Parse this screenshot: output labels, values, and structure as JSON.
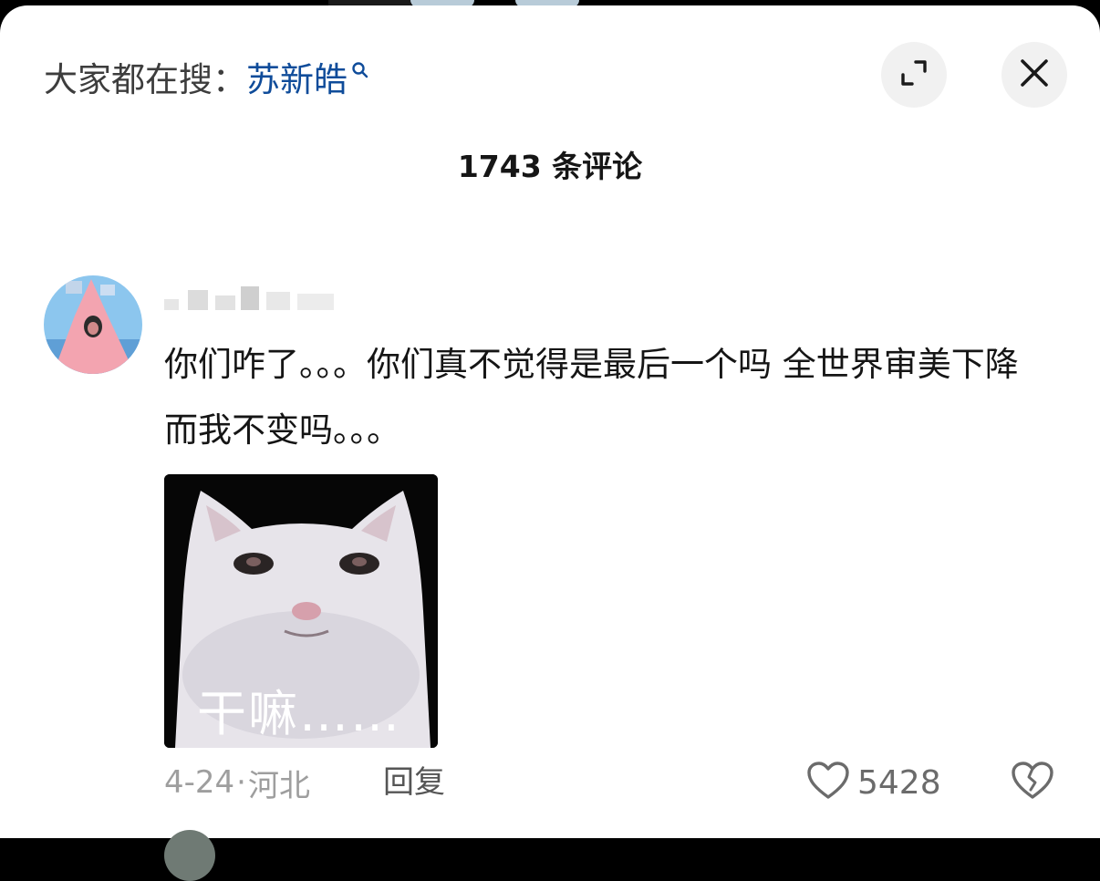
{
  "header": {
    "search_hint_prefix": "大家都在搜：",
    "search_keyword": "苏新皓",
    "search_icon": "search-icon",
    "expand_icon": "expand-icon",
    "close_icon": "close-icon"
  },
  "comments_title": "1743 条评论",
  "comment": {
    "avatar_icon": "avatar-patrick-star",
    "username_obscured": true,
    "text": "你们咋了。。。你们真不觉得是最后一个吗 全世界审美下降而我不变吗。。。",
    "sticker_caption": "干嘛……",
    "date": "4-24",
    "separator": "·",
    "location": "河北",
    "reply_label": "回复",
    "like_icon": "heart-outline-icon",
    "like_count": "5428",
    "dislike_icon": "broken-heart-icon"
  },
  "colors": {
    "keyword": "#0f4c9a",
    "meta_grey": "#9e9e9e",
    "button_bg": "#f1f1f1"
  }
}
